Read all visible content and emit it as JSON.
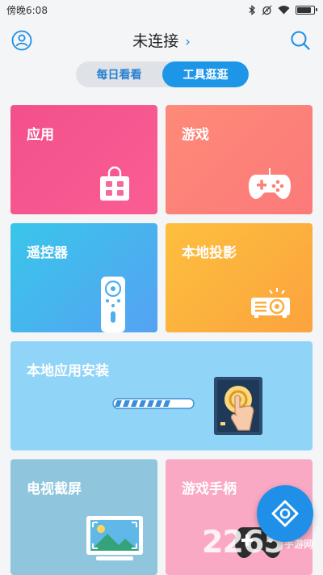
{
  "status_bar": {
    "time": "傍晚6:08",
    "battery_level": 0.9
  },
  "header": {
    "title": "未连接",
    "chevron": "›"
  },
  "tabs": [
    {
      "label": "每日看看",
      "active": false
    },
    {
      "label": "工具逛逛",
      "active": true
    }
  ],
  "cards": [
    {
      "label": "应用",
      "icon": "shopping-bag-icon"
    },
    {
      "label": "游戏",
      "icon": "gamepad-icon"
    },
    {
      "label": "遥控器",
      "icon": "remote-control-icon"
    },
    {
      "label": "本地投影",
      "icon": "projector-icon"
    },
    {
      "label": "本地应用安装",
      "icon": "install-icon"
    },
    {
      "label": "电视截屏",
      "icon": "tv-screenshot-icon"
    },
    {
      "label": "游戏手柄",
      "icon": "gamepad-controller-icon"
    }
  ],
  "watermark": {
    "text": "手游网",
    "number": "2265"
  },
  "colors": {
    "accent": "#1e96e8"
  }
}
